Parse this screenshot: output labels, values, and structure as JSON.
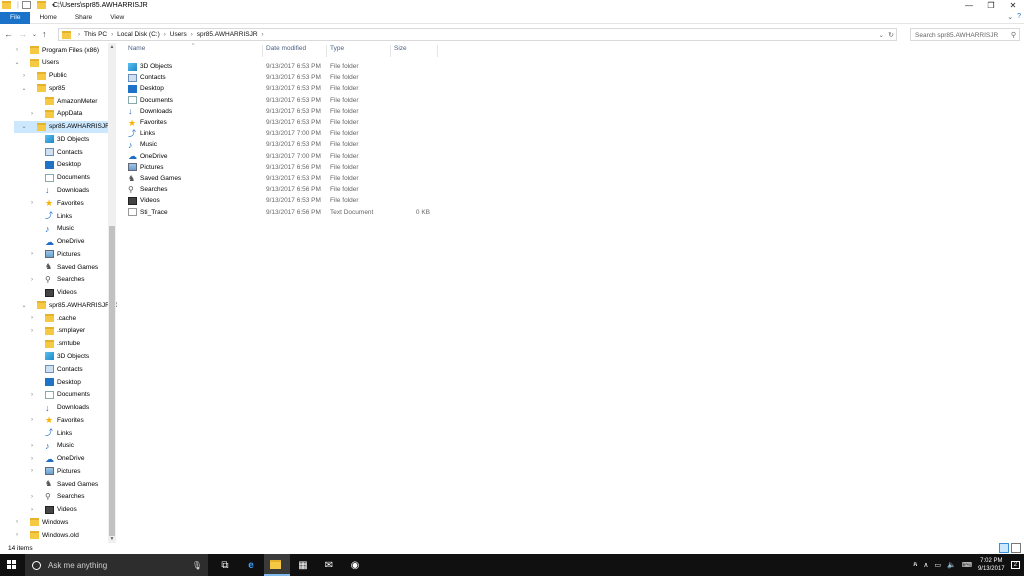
{
  "window": {
    "title": "C:\\Users\\spr85.AWHARRISJR"
  },
  "ribbon": {
    "tabs": [
      "File",
      "Home",
      "Share",
      "View"
    ],
    "help_icon": "help-icon"
  },
  "address": {
    "crumbs": [
      "This PC",
      "Local Disk (C:)",
      "Users",
      "spr85.AWHARRISJR"
    ],
    "search_placeholder": "Search spr85.AWHARRISJR"
  },
  "nav_tree": [
    {
      "label": "Program Files (x86)",
      "icon": "folder",
      "level": 1,
      "chev": ">"
    },
    {
      "label": "Users",
      "icon": "folder",
      "level": 1,
      "chev": "v"
    },
    {
      "label": "Public",
      "icon": "folder",
      "level": 2,
      "chev": ">"
    },
    {
      "label": "spr85",
      "icon": "folder",
      "level": 2,
      "chev": "v"
    },
    {
      "label": "AmazonMeter",
      "icon": "folder",
      "level": 3,
      "chev": ""
    },
    {
      "label": "AppData",
      "icon": "folder",
      "level": 3,
      "chev": ">"
    },
    {
      "label": "spr85.AWHARRISJR",
      "icon": "folder",
      "level": 2,
      "chev": "v",
      "selected": true
    },
    {
      "label": "3D Objects",
      "icon": "obj3d",
      "level": 3,
      "chev": ""
    },
    {
      "label": "Contacts",
      "icon": "contacts",
      "level": 3,
      "chev": ""
    },
    {
      "label": "Desktop",
      "icon": "desk",
      "level": 3,
      "chev": ""
    },
    {
      "label": "Documents",
      "icon": "doc",
      "level": 3,
      "chev": ""
    },
    {
      "label": "Downloads",
      "icon": "dl",
      "level": 3,
      "chev": ""
    },
    {
      "label": "Favorites",
      "icon": "star",
      "level": 3,
      "chev": ">"
    },
    {
      "label": "Links",
      "icon": "link",
      "level": 3,
      "chev": ""
    },
    {
      "label": "Music",
      "icon": "music",
      "level": 3,
      "chev": ""
    },
    {
      "label": "OneDrive",
      "icon": "cloud",
      "level": 3,
      "chev": ""
    },
    {
      "label": "Pictures",
      "icon": "pic",
      "level": 3,
      "chev": ">"
    },
    {
      "label": "Saved Games",
      "icon": "game",
      "level": 3,
      "chev": ""
    },
    {
      "label": "Searches",
      "icon": "search",
      "level": 3,
      "chev": ">"
    },
    {
      "label": "Videos",
      "icon": "video",
      "level": 3,
      "chev": ""
    },
    {
      "label": "spr85.AWHARRISJR.000",
      "icon": "folder",
      "level": 2,
      "chev": "v"
    },
    {
      "label": ".cache",
      "icon": "folder",
      "level": 3,
      "chev": ">"
    },
    {
      "label": ".smplayer",
      "icon": "folder",
      "level": 3,
      "chev": ">"
    },
    {
      "label": ".smtube",
      "icon": "folder",
      "level": 3,
      "chev": ""
    },
    {
      "label": "3D Objects",
      "icon": "obj3d",
      "level": 3,
      "chev": ""
    },
    {
      "label": "Contacts",
      "icon": "contacts",
      "level": 3,
      "chev": ""
    },
    {
      "label": "Desktop",
      "icon": "desk",
      "level": 3,
      "chev": ""
    },
    {
      "label": "Documents",
      "icon": "doc",
      "level": 3,
      "chev": ">"
    },
    {
      "label": "Downloads",
      "icon": "dl",
      "level": 3,
      "chev": ""
    },
    {
      "label": "Favorites",
      "icon": "star",
      "level": 3,
      "chev": ">"
    },
    {
      "label": "Links",
      "icon": "link",
      "level": 3,
      "chev": ""
    },
    {
      "label": "Music",
      "icon": "music",
      "level": 3,
      "chev": ">"
    },
    {
      "label": "OneDrive",
      "icon": "cloud",
      "level": 3,
      "chev": ">"
    },
    {
      "label": "Pictures",
      "icon": "pic",
      "level": 3,
      "chev": ">"
    },
    {
      "label": "Saved Games",
      "icon": "game",
      "level": 3,
      "chev": ""
    },
    {
      "label": "Searches",
      "icon": "search",
      "level": 3,
      "chev": ">"
    },
    {
      "label": "Videos",
      "icon": "video",
      "level": 3,
      "chev": ">"
    },
    {
      "label": "Windows",
      "icon": "folder",
      "level": 1,
      "chev": ">"
    },
    {
      "label": "Windows.old",
      "icon": "folder",
      "level": 1,
      "chev": ">"
    }
  ],
  "columns": {
    "name": "Name",
    "date": "Date modified",
    "type": "Type",
    "size": "Size"
  },
  "files": [
    {
      "name": "3D Objects",
      "icon": "obj3d",
      "date": "9/13/2017 6:53 PM",
      "type": "File folder",
      "size": ""
    },
    {
      "name": "Contacts",
      "icon": "contacts",
      "date": "9/13/2017 6:53 PM",
      "type": "File folder",
      "size": ""
    },
    {
      "name": "Desktop",
      "icon": "desk",
      "date": "9/13/2017 6:53 PM",
      "type": "File folder",
      "size": ""
    },
    {
      "name": "Documents",
      "icon": "doc",
      "date": "9/13/2017 6:53 PM",
      "type": "File folder",
      "size": ""
    },
    {
      "name": "Downloads",
      "icon": "dl",
      "date": "9/13/2017 6:53 PM",
      "type": "File folder",
      "size": ""
    },
    {
      "name": "Favorites",
      "icon": "star",
      "date": "9/13/2017 6:53 PM",
      "type": "File folder",
      "size": ""
    },
    {
      "name": "Links",
      "icon": "link",
      "date": "9/13/2017 7:00 PM",
      "type": "File folder",
      "size": ""
    },
    {
      "name": "Music",
      "icon": "music",
      "date": "9/13/2017 6:53 PM",
      "type": "File folder",
      "size": ""
    },
    {
      "name": "OneDrive",
      "icon": "cloud",
      "date": "9/13/2017 7:00 PM",
      "type": "File folder",
      "size": ""
    },
    {
      "name": "Pictures",
      "icon": "pic",
      "date": "9/13/2017 6:56 PM",
      "type": "File folder",
      "size": ""
    },
    {
      "name": "Saved Games",
      "icon": "game",
      "date": "9/13/2017 6:53 PM",
      "type": "File folder",
      "size": ""
    },
    {
      "name": "Searches",
      "icon": "search",
      "date": "9/13/2017 6:56 PM",
      "type": "File folder",
      "size": ""
    },
    {
      "name": "Videos",
      "icon": "video",
      "date": "9/13/2017 6:53 PM",
      "type": "File folder",
      "size": ""
    },
    {
      "name": "Sti_Trace",
      "icon": "txt",
      "date": "9/13/2017 6:56 PM",
      "type": "Text Document",
      "size": "0 KB"
    }
  ],
  "status": {
    "item_count": "14 items"
  },
  "taskbar": {
    "search_placeholder": "Ask me anything",
    "time": "7:02 PM",
    "date": "9/13/2017",
    "notification_count": "2"
  },
  "colors": {
    "accent": "#1a73c8",
    "selection": "#cce8ff",
    "taskbar": "#101010"
  }
}
